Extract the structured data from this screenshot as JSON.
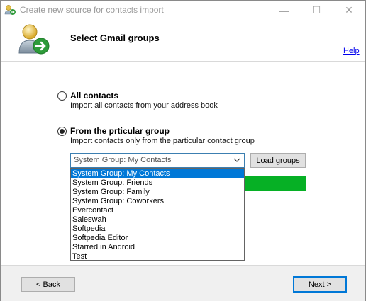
{
  "window": {
    "title": "Create new source for contacts import",
    "minimize_glyph": "—",
    "maximize_glyph": "☐",
    "close_glyph": "✕"
  },
  "header": {
    "title": "Select Gmail groups",
    "help_label": "Help"
  },
  "options": {
    "all": {
      "title": "All contacts",
      "description": "Import all contacts from your address book",
      "selected": false
    },
    "group": {
      "title": "From the prticular group",
      "description": "Import contacts only from the particular contact group",
      "selected": true
    }
  },
  "group_select": {
    "value": "System Group: My Contacts",
    "options": [
      "System Group: My Contacts",
      "System Group: Friends",
      "System Group: Family",
      "System Group: Coworkers",
      "Evercontact",
      "Saleswah",
      "Softpedia",
      "Softpedia Editor",
      "Starred in Android",
      "Test"
    ],
    "highlighted_index": 0
  },
  "load_groups_label": "Load groups",
  "footer": {
    "back_label": "< Back",
    "next_label": "Next >"
  },
  "colors": {
    "progress": "#06b025",
    "selection": "#0078d7",
    "link": "#0000ee"
  }
}
